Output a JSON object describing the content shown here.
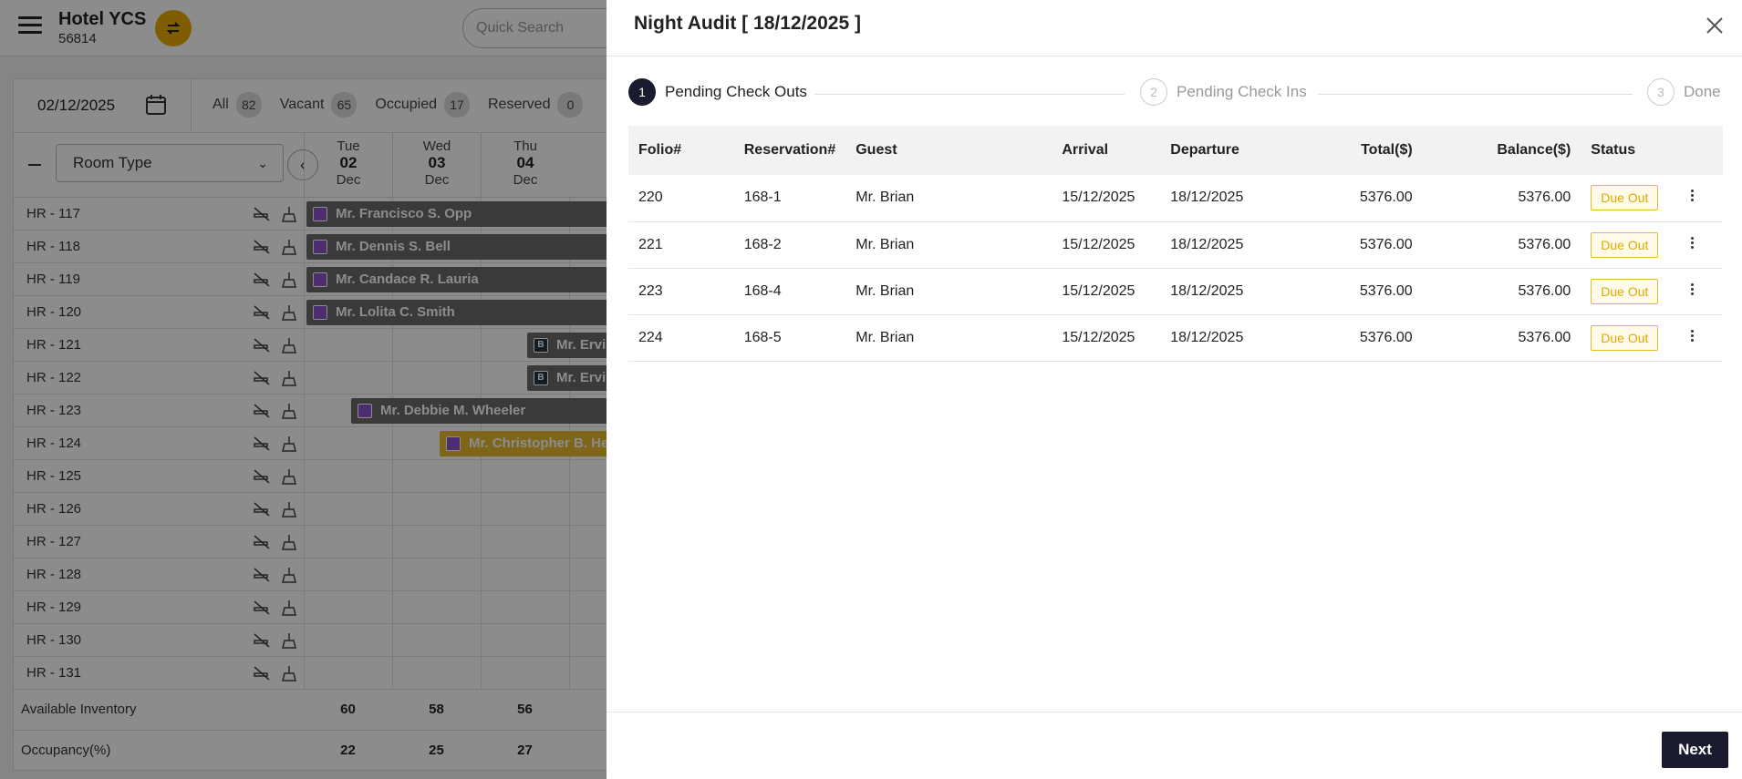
{
  "app": {
    "hotel_name": "Hotel YCS",
    "hotel_id": "56814",
    "search_placeholder": "Quick Search"
  },
  "calendar": {
    "date": "02/12/2025",
    "filters": [
      {
        "label": "All",
        "count": "82"
      },
      {
        "label": "Vacant",
        "count": "65"
      },
      {
        "label": "Occupied",
        "count": "17"
      },
      {
        "label": "Reserved",
        "count": "0"
      }
    ],
    "room_type_label": "Room Type",
    "days": [
      {
        "dow": "Tue",
        "num": "02",
        "mon": "Dec"
      },
      {
        "dow": "Wed",
        "num": "03",
        "mon": "Dec"
      },
      {
        "dow": "Thu",
        "num": "04",
        "mon": "Dec"
      }
    ],
    "rooms": [
      {
        "name": "HR - 117",
        "booking": "Mr. Francisco S. Opp"
      },
      {
        "name": "HR - 118",
        "booking": "Mr. Dennis S. Bell"
      },
      {
        "name": "HR - 119",
        "booking": "Mr. Candace R. Lauria"
      },
      {
        "name": "HR - 120",
        "booking": "Mr. Lolita C. Smith"
      },
      {
        "name": "HR - 121",
        "booking": "Mr. Ervin"
      },
      {
        "name": "HR - 122",
        "booking": "Mr. Ervin"
      },
      {
        "name": "HR - 123",
        "booking": "Mr. Debbie M. Wheeler"
      },
      {
        "name": "HR - 124",
        "booking": "Mr. Christopher B. Hen"
      },
      {
        "name": "HR - 125",
        "booking": ""
      },
      {
        "name": "HR - 126",
        "booking": ""
      },
      {
        "name": "HR - 127",
        "booking": ""
      },
      {
        "name": "HR - 128",
        "booking": ""
      },
      {
        "name": "HR - 129",
        "booking": ""
      },
      {
        "name": "HR - 130",
        "booking": ""
      },
      {
        "name": "HR - 131",
        "booking": ""
      }
    ],
    "available_inventory_label": "Available Inventory",
    "available_inventory": [
      "60",
      "58",
      "56"
    ],
    "occupancy_label": "Occupancy(%)",
    "occupancy": [
      "22",
      "25",
      "27"
    ]
  },
  "drawer": {
    "title": "Night Audit [ 18/12/2025 ]",
    "steps": [
      {
        "num": "1",
        "label": "Pending Check Outs"
      },
      {
        "num": "2",
        "label": "Pending Check Ins"
      },
      {
        "num": "3",
        "label": "Done"
      }
    ],
    "columns": [
      "Folio#",
      "Reservation#",
      "Guest",
      "Arrival",
      "Departure",
      "Total($)",
      "Balance($)",
      "Status"
    ],
    "rows": [
      {
        "folio": "220",
        "reservation": "168-1",
        "guest": "Mr. Brian",
        "arrival": "15/12/2025",
        "departure": "18/12/2025",
        "total": "5376.00",
        "balance": "5376.00",
        "status": "Due Out"
      },
      {
        "folio": "221",
        "reservation": "168-2",
        "guest": "Mr. Brian",
        "arrival": "15/12/2025",
        "departure": "18/12/2025",
        "total": "5376.00",
        "balance": "5376.00",
        "status": "Due Out"
      },
      {
        "folio": "223",
        "reservation": "168-4",
        "guest": "Mr. Brian",
        "arrival": "15/12/2025",
        "departure": "18/12/2025",
        "total": "5376.00",
        "balance": "5376.00",
        "status": "Due Out"
      },
      {
        "folio": "224",
        "reservation": "168-5",
        "guest": "Mr. Brian",
        "arrival": "15/12/2025",
        "departure": "18/12/2025",
        "total": "5376.00",
        "balance": "5376.00",
        "status": "Due Out"
      }
    ],
    "next_label": "Next"
  }
}
